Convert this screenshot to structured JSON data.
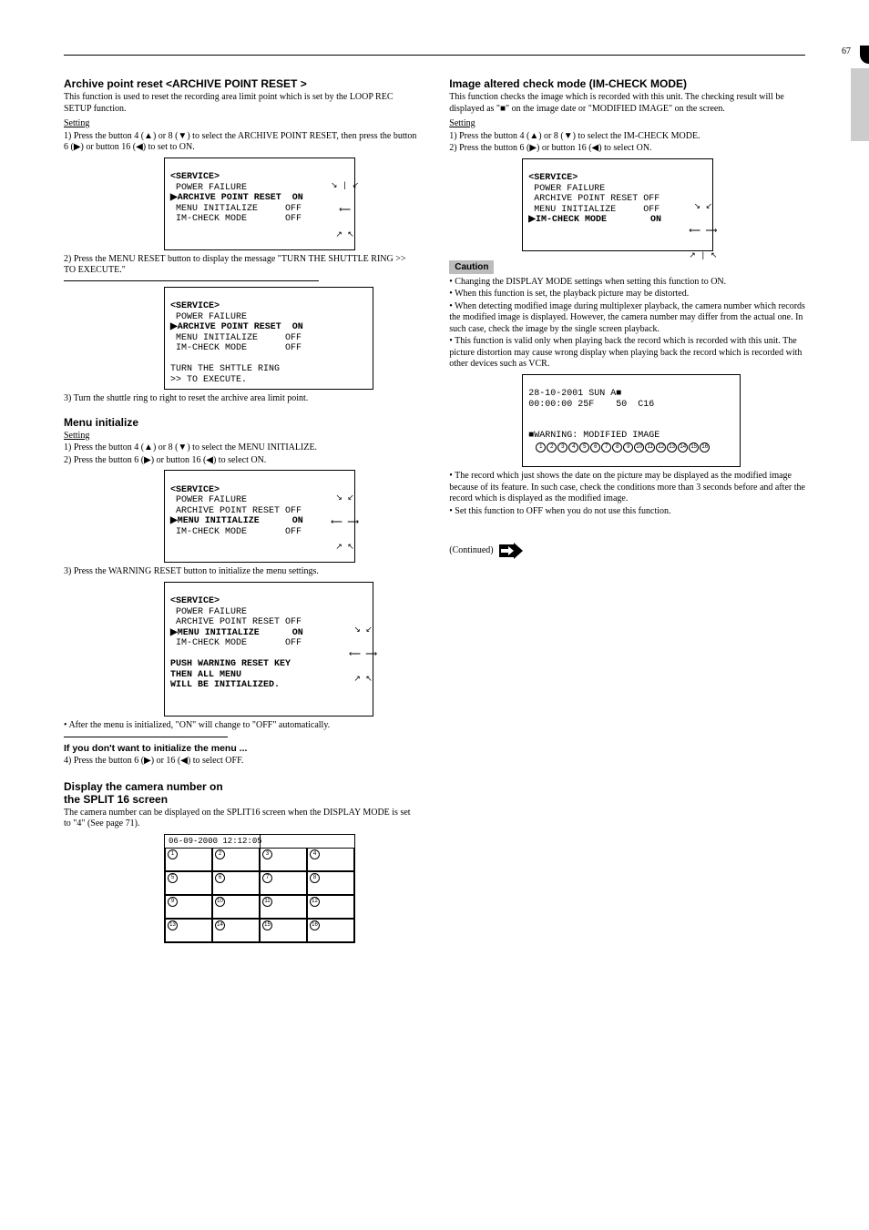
{
  "page_number": "67",
  "left": {
    "s1": {
      "heading": "Archive point reset <ARCHIVE POINT RESET >",
      "p1": "This function is used to reset the recording area limit point which is set by the LOOP REC SETUP function.",
      "sub1": "Setting",
      "step1": "1) Press the button 4 (▲) or 8 (▼) to select the ARCHIVE POINT RESET, then press the button 6 (▶) or button 16 (◀) to set to ON.",
      "step2": "2) Press the MENU RESET button to display the message \"TURN THE SHUTTLE RING >> TO EXECUTE.\"",
      "step3": "3) Turn the shuttle ring to right to reset the archive area limit point."
    },
    "s2": {
      "heading": "Menu initialize",
      "sub1": "Setting",
      "step1": "1) Press the button 4 (▲) or 8 (▼) to select the MENU INITIALIZE.",
      "step2": "2) Press the button 6 (▶) or button 16 (◀) to select ON.",
      "step3": "3) Press the WARNING RESET button to initialize the menu settings.",
      "step_after": "• After the menu is initialized, \"ON\" will change to \"OFF\" automatically.",
      "note_title": "If you don't want to initialize the menu ...",
      "note_step": "4) Press the button 6 (▶) or 16 (◀) to select OFF."
    },
    "split_title_a": "Display the camera number on",
    "split_title_b": "the SPLIT 16 screen",
    "split_p": "The camera number can be displayed on the SPLIT16 screen when the DISPLAY MODE is set to \"4\" (See page 71)."
  },
  "right": {
    "im": {
      "heading": "Image altered check mode (IM-CHECK MODE)",
      "p1": "This function checks the image which is recorded with this unit. The checking result will be displayed as \"■\" on the image date or \"MODIFIED IMAGE\" on the screen.",
      "sub1": "Setting",
      "step1": "1) Press the button 4 (▲) or 8 (▼) to select the IM-CHECK MODE.",
      "step2": "2) Press the button 6 (▶) or button 16 (◀) to select ON.",
      "caution_label": "Caution",
      "bullets": [
        "Changing the DISPLAY MODE settings when setting this function to ON.",
        "When this function is set, the playback picture may be distorted.",
        "When detecting modified image during multiplexer playback, the camera number which records the modified image is displayed. However, the camera number may differ from the actual one. In such case, check the image by the single screen playback.",
        "This function is valid only when playing back the record which is recorded with this unit. The picture distortion may cause wrong display when playing back the record which is recorded with other devices such as VCR.",
        "The record which just shows the date on the picture may be displayed as the modified image because of its feature. In such case, check the conditions more than 3 seconds before and after the record which is displayed as the modified image.",
        "Set this function to OFF when you do not use this function."
      ]
    },
    "continued": "(Continued)",
    "continued_arrow": "→"
  },
  "menus": {
    "m1": {
      "title": "<SERVICE>",
      "rows": [
        "POWER FAILURE",
        "ARCHIVE POINT RESET  ON",
        "MENU INITIALIZE     OFF",
        "IM-CHECK MODE       OFF"
      ],
      "highlight_index": 1
    },
    "m2": {
      "title": "<SERVICE>",
      "rows": [
        "POWER FAILURE",
        "ARCHIVE POINT RESET  ON",
        "MENU INITIALIZE     OFF",
        "IM-CHECK MODE       OFF"
      ],
      "highlight_index": 1,
      "footer": "TURN THE SHTTLE RING\n>> TO EXECUTE."
    },
    "m3": {
      "title": "<SERVICE>",
      "rows": [
        "POWER FAILURE",
        "ARCHIVE POINT RESET OFF",
        "MENU INITIALIZE      ON",
        "IM-CHECK MODE       OFF"
      ],
      "highlight_index": 2
    },
    "m4": {
      "title": "<SERVICE>",
      "rows": [
        "POWER FAILURE",
        "ARCHIVE POINT RESET OFF",
        "MENU INITIALIZE      ON",
        "IM-CHECK MODE       OFF"
      ],
      "highlight_index": 2,
      "footer": "PUSH WARNING RESET KEY\nTHEN ALL MENU\nWILL BE INITIALIZED."
    },
    "m5": {
      "title": "<SERVICE>",
      "rows": [
        "POWER FAILURE",
        "ARCHIVE POINT RESET OFF",
        "MENU INITIALIZE     OFF",
        "IM-CHECK MODE        ON"
      ],
      "highlight_index": 3
    }
  },
  "warnbox": {
    "line1": "28-10-2001 SUN A■",
    "line2": "00:00:00 25F    50  C16",
    "line3": "■WARNING: MODIFIED IMAGE",
    "cams": [
      "1",
      "2",
      "3",
      "4",
      "5",
      "6",
      "7",
      "8",
      "9",
      "10",
      "11",
      "12",
      "13",
      "14",
      "15",
      "16"
    ]
  },
  "gridbox": {
    "header": "06-09-2000 12:12:05",
    "cells": [
      "1",
      "2",
      "3",
      "4",
      "5",
      "6",
      "7",
      "8",
      "9",
      "10",
      "11",
      "12",
      "13",
      "14",
      "15",
      "16"
    ]
  }
}
